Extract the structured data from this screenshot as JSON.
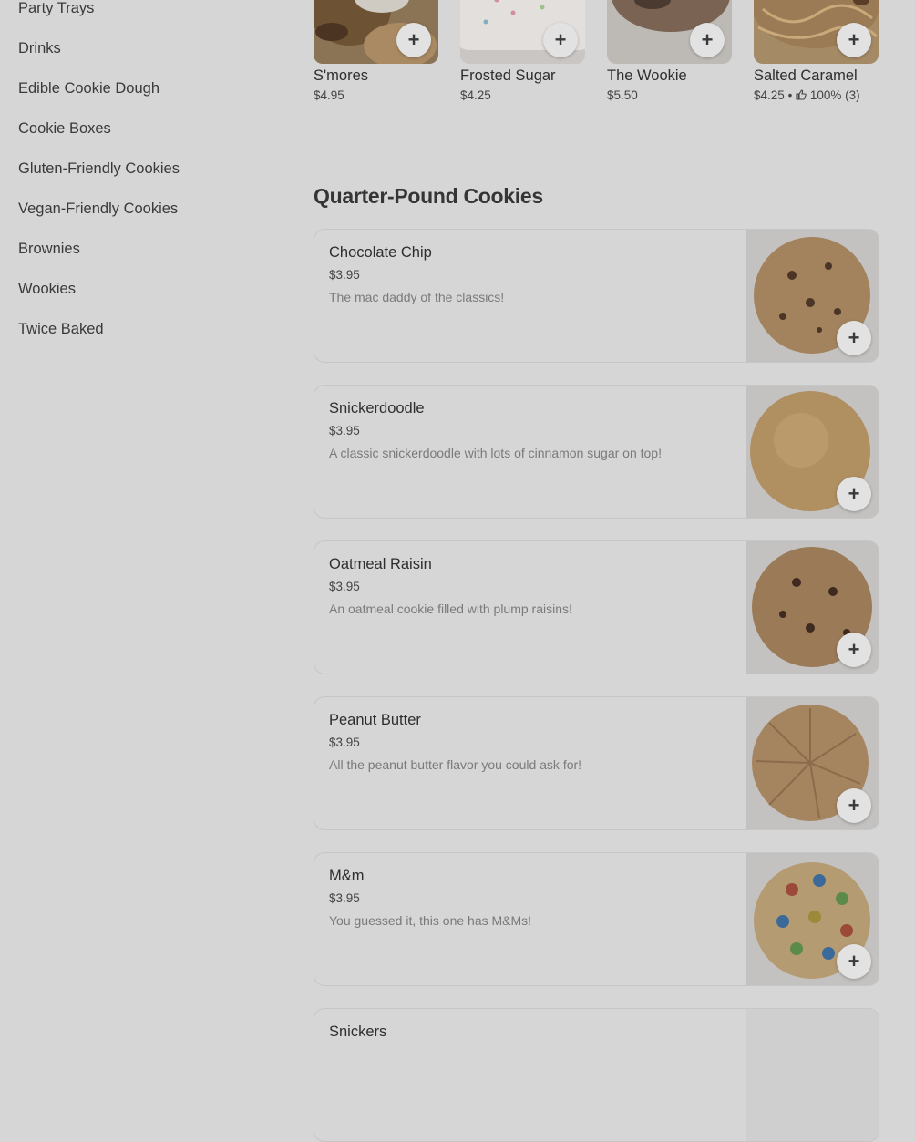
{
  "sidebar": {
    "items": [
      {
        "label": "Party Trays"
      },
      {
        "label": "Drinks"
      },
      {
        "label": "Edible Cookie Dough"
      },
      {
        "label": "Cookie Boxes"
      },
      {
        "label": "Gluten-Friendly Cookies"
      },
      {
        "label": "Vegan-Friendly Cookies"
      },
      {
        "label": "Brownies"
      },
      {
        "label": "Wookies"
      },
      {
        "label": "Twice Baked"
      }
    ]
  },
  "featured": [
    {
      "name": "S'mores",
      "price": "$4.95"
    },
    {
      "name": "Frosted Sugar",
      "price": "$4.25"
    },
    {
      "name": "The Wookie",
      "price": "$5.50"
    },
    {
      "name": "Salted Caramel",
      "price": "$4.25",
      "separator": "•",
      "rating_pct": "100%",
      "rating_count": "(3)"
    }
  ],
  "add_symbol": "+",
  "section": {
    "title": "Quarter-Pound Cookies"
  },
  "items": [
    {
      "name": "Chocolate Chip",
      "price": "$3.95",
      "description": "The mac daddy of the classics!"
    },
    {
      "name": "Snickerdoodle",
      "price": "$3.95",
      "description": "A classic snickerdoodle with lots of cinnamon sugar on top!"
    },
    {
      "name": "Oatmeal Raisin",
      "price": "$3.95",
      "description": "An oatmeal cookie filled with plump raisins!"
    },
    {
      "name": "Peanut Butter",
      "price": "$3.95",
      "description": "All the peanut butter flavor you could ask for!"
    },
    {
      "name": "M&m",
      "price": "$3.95",
      "description": "You guessed it, this one has M&Ms!"
    },
    {
      "name": "Snickers",
      "price": "",
      "description": ""
    }
  ],
  "icons": {
    "add": "plus-icon",
    "rating": "thumbs-up-icon"
  },
  "colors": {
    "background": "#d6d6d6",
    "card_border": "#c6c6c6",
    "button": "#e2e2e2"
  }
}
